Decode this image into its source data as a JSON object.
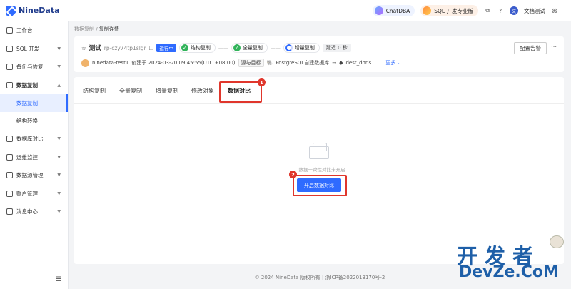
{
  "app": {
    "logo_text": "NineData"
  },
  "topbar": {
    "chatdba_label": "ChatDBA",
    "sql_edition_label": "SQL 开发专业版",
    "user_initial": "文",
    "user_name": "文档测试"
  },
  "sidebar": {
    "items": [
      {
        "label": "工作台"
      },
      {
        "label": "SQL 开发"
      },
      {
        "label": "备份与恢复"
      },
      {
        "label": "数据复制"
      },
      {
        "label": "数据库对比"
      },
      {
        "label": "运维监控"
      },
      {
        "label": "数据源管理"
      },
      {
        "label": "账户管理"
      },
      {
        "label": "消息中心"
      }
    ],
    "sub_items": [
      {
        "label": "数据复制"
      },
      {
        "label": "结构转换"
      }
    ]
  },
  "breadcrumb": {
    "parent": "数据复制",
    "separator": "/",
    "current": "复制详情"
  },
  "task": {
    "name": "测试",
    "id": "rp-czy74tp1slgr",
    "status": "运行中",
    "steps": [
      {
        "label": "结构复制"
      },
      {
        "label": "全量复制"
      },
      {
        "label": "增量复制"
      }
    ],
    "delay_label": "延迟",
    "delay_value": "0 秒",
    "alert_button": "配置告警",
    "creator": "ninedata-test1",
    "created_text": "创建于 2024-03-20 09:45:55(UTC +08:00)",
    "route_label": "源与目标",
    "source": "PostgreSQL自建数据库",
    "target": "dest_doris",
    "more_label": "更多"
  },
  "tabs": [
    {
      "label": "结构复制"
    },
    {
      "label": "全量复制"
    },
    {
      "label": "增量复制"
    },
    {
      "label": "修改对象"
    },
    {
      "label": "数据对比"
    }
  ],
  "empty_state": {
    "text": "数据一致性对比未开启",
    "button_label": "开启数据对比"
  },
  "annotations": {
    "num1": "1",
    "num2": "2"
  },
  "footer": {
    "text": "© 2024 NineData 版权所有  |  浙ICP备2022013170号-2"
  },
  "watermark": {
    "cn": "开发者",
    "en": "DevZe.CoM"
  },
  "colors": {
    "accent": "#2f6bff",
    "success": "#32b35a",
    "highlight": "#e0362c"
  }
}
